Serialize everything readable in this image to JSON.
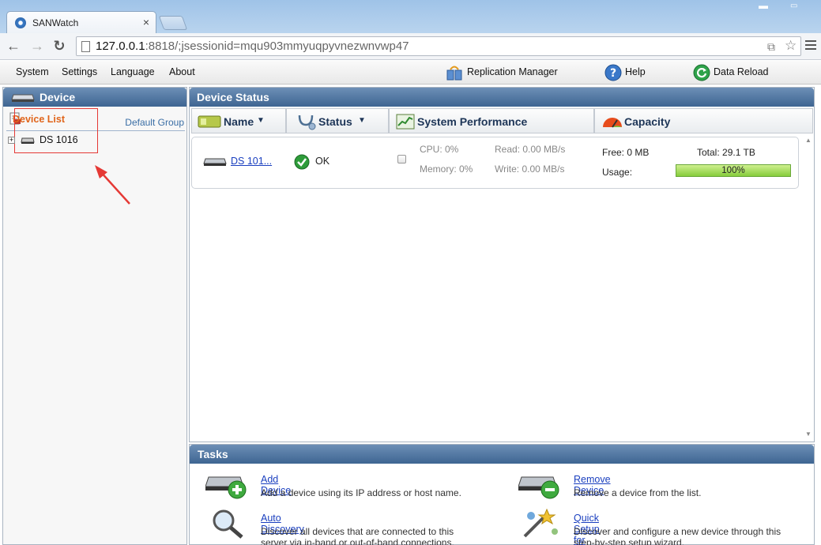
{
  "browser": {
    "tab_title": "SANWatch",
    "tab_close": "×",
    "url_host": "127.0.0.1",
    "url_port": ":8818",
    "url_path": "/;jsessionid=mqu903mmyuqpyvnezwnvwp47",
    "back": "←",
    "forward": "→",
    "reload": "↻",
    "star": "☆"
  },
  "menu": {
    "items": [
      "System",
      "Settings",
      "Language",
      "About"
    ],
    "replication": "Replication Manager",
    "help": "Help",
    "reload": "Data Reload"
  },
  "left": {
    "header": "Device",
    "device_list": "Device List",
    "default_group": "Default Group",
    "tree_item": "DS 1016",
    "expand": "+"
  },
  "status": {
    "header": "Device Status",
    "columns": [
      "Name",
      "Status",
      "System Performance",
      "Capacity"
    ],
    "row": {
      "name": "DS 101...",
      "status": "OK",
      "cpu": "CPU: 0%",
      "memory": "Memory: 0%",
      "read": "Read: 0.00 MB/s",
      "write": "Write: 0.00 MB/s",
      "free": "Free: 0 MB",
      "total": "Total: 29.1 TB",
      "usage_label": "Usage:",
      "usage": "100%",
      "usage_fraction": 1.0
    }
  },
  "tasks": {
    "header": "Tasks",
    "items": [
      {
        "title": "Add Device",
        "desc": "Add a device using its IP address or host name."
      },
      {
        "title": "Remove Device",
        "desc": "Remove a device from the list."
      },
      {
        "title": "Auto Discovery",
        "desc": "Discover all devices that are connected to this server via in-band or out-of-band connections."
      },
      {
        "title": "Quick Setup for New Device",
        "desc": "Discover and configure a new device through this step-by-step setup wizard."
      }
    ]
  },
  "colors": {
    "accent_orange": "#e0651b",
    "panel_header": "#3e6592",
    "link": "#1a3fbf",
    "annotation_red": "#e53935"
  }
}
